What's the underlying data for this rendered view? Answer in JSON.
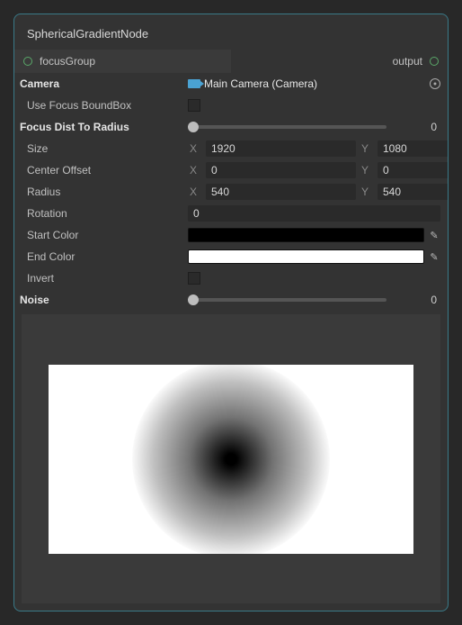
{
  "node": {
    "title": "SphericalGradientNode"
  },
  "ports": {
    "input_label": "focusGroup",
    "output_label": "output"
  },
  "props": {
    "camera_label": "Camera",
    "camera_value": "Main Camera (Camera)",
    "use_bbox_label": "Use Focus BoundBox",
    "focus_dist_label": "Focus Dist To Radius",
    "focus_dist_value": "0",
    "size_label": "Size",
    "size_x": "1920",
    "size_y": "1080",
    "center_label": "Center Offset",
    "center_x": "0",
    "center_y": "0",
    "radius_label": "Radius",
    "radius_x": "540",
    "radius_y": "540",
    "rotation_label": "Rotation",
    "rotation_value": "0",
    "start_color_label": "Start Color",
    "start_color_value": "#000000",
    "end_color_label": "End Color",
    "end_color_value": "#ffffff",
    "invert_label": "Invert",
    "noise_label": "Noise",
    "noise_value": "0",
    "axis_x": "X",
    "axis_y": "Y"
  }
}
